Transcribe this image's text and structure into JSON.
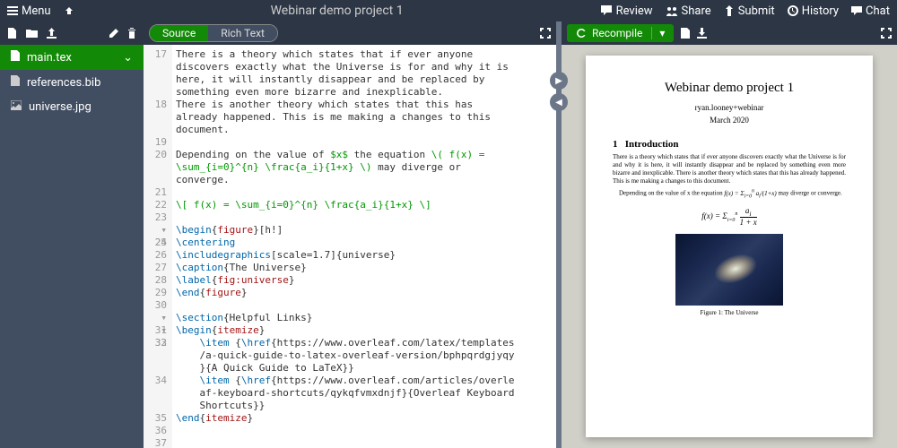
{
  "topbar": {
    "menu": "Menu",
    "title": "Webinar demo project 1",
    "review": "Review",
    "share": "Share",
    "submit": "Submit",
    "history": "History",
    "chat": "Chat"
  },
  "sidebar": {
    "files": [
      {
        "name": "main.tex",
        "icon": "file",
        "selected": true
      },
      {
        "name": "references.bib",
        "icon": "file",
        "selected": false
      },
      {
        "name": "universe.jpg",
        "icon": "image",
        "selected": false
      }
    ]
  },
  "editor": {
    "tabs": {
      "source": "Source",
      "rich": "Rich Text"
    },
    "lines": [
      {
        "n": "17",
        "fold": "",
        "t": "There is a theory which states that if ever anyone"
      },
      {
        "n": "",
        "t": "discovers exactly what the Universe is for and why it is"
      },
      {
        "n": "",
        "t": "here, it will instantly disappear and be replaced by"
      },
      {
        "n": "",
        "t": "something even more bizarre and inexplicable."
      },
      {
        "n": "18",
        "t": "There is another theory which states that this has"
      },
      {
        "n": "",
        "t": "already happened. This is me making a changes to this"
      },
      {
        "n": "",
        "t": "document."
      },
      {
        "n": "19",
        "t": ""
      },
      {
        "n": "20",
        "t": "Depending on the value of <span class='math'>$x$</span> the equation <span class='math'>\\( f(x) = </span>"
      },
      {
        "n": "",
        "t": "<span class='math'>\\sum_{i=0}^{n} \\frac{a_i}{1+x} \\)</span> may diverge or"
      },
      {
        "n": "",
        "t": "converge."
      },
      {
        "n": "21",
        "t": ""
      },
      {
        "n": "22",
        "t": "<span class='math'>\\[ f(x) = \\sum_{i=0}^{n} \\frac{a_i}{1+x} \\]</span>"
      },
      {
        "n": "23",
        "t": ""
      },
      {
        "n": "24",
        "fold": "▾",
        "t": "<span class='cm'>\\begin</span>{<span class='arg'>figure</span>}[h!]"
      },
      {
        "n": "25",
        "t": "<span class='cm'>\\centering</span>"
      },
      {
        "n": "26",
        "t": "<span class='cm'>\\includegraphics</span>[scale=1.7]{universe}"
      },
      {
        "n": "27",
        "t": "<span class='cm'>\\caption</span>{The Universe}"
      },
      {
        "n": "28",
        "t": "<span class='cm'>\\label</span>{<span class='arg'>fig:universe</span>}"
      },
      {
        "n": "29",
        "t": "<span class='cm'>\\end</span>{<span class='arg'>figure</span>}"
      },
      {
        "n": "30",
        "t": ""
      },
      {
        "n": "31",
        "fold": "▾",
        "t": "<span class='cm'>\\section</span>{Helpful Links}"
      },
      {
        "n": "32",
        "fold": "▾",
        "t": "<span class='cm'>\\begin</span>{<span class='arg'>itemize</span>}"
      },
      {
        "n": "33",
        "t": "    <span class='cm'>\\item</span> {<span class='cm'>\\href</span>{https://www.overleaf.com/latex/templates"
      },
      {
        "n": "",
        "t": "    /a-quick-guide-to-latex-overleaf-version/bphpqrdgjyqy"
      },
      {
        "n": "",
        "t": "    }{A Quick Guide to LaTeX}}"
      },
      {
        "n": "34",
        "t": "    <span class='cm'>\\item</span> {<span class='cm'>\\href</span>{https://www.overleaf.com/articles/overle"
      },
      {
        "n": "",
        "t": "    af-keyboard-shortcuts/qykqfvmxdnjf}{Overleaf Keyboard"
      },
      {
        "n": "",
        "t": "    Shortcuts}}"
      },
      {
        "n": "35",
        "t": "<span class='cm'>\\end</span>{<span class='arg'>itemize</span>}"
      },
      {
        "n": "36",
        "t": ""
      },
      {
        "n": "37",
        "t": ""
      }
    ]
  },
  "preview": {
    "recompile": "Recompile",
    "doc": {
      "title": "Webinar demo project 1",
      "author": "ryan.looney+webinar",
      "date": "March 2020",
      "section_num": "1",
      "section": "Introduction",
      "para1": "There is a theory which states that if ever anyone discovers exactly what the Universe is for and why it is here, it will instantly disappear and be replaced by something even more bizarre and inexplicable. There is another theory which states that this has already happened. This is me making a changes to this document.",
      "para2_prefix": "Depending on the value of x the equation ",
      "para2_suffix": " may diverge or converge.",
      "figcap": "Figure 1: The Universe"
    }
  }
}
